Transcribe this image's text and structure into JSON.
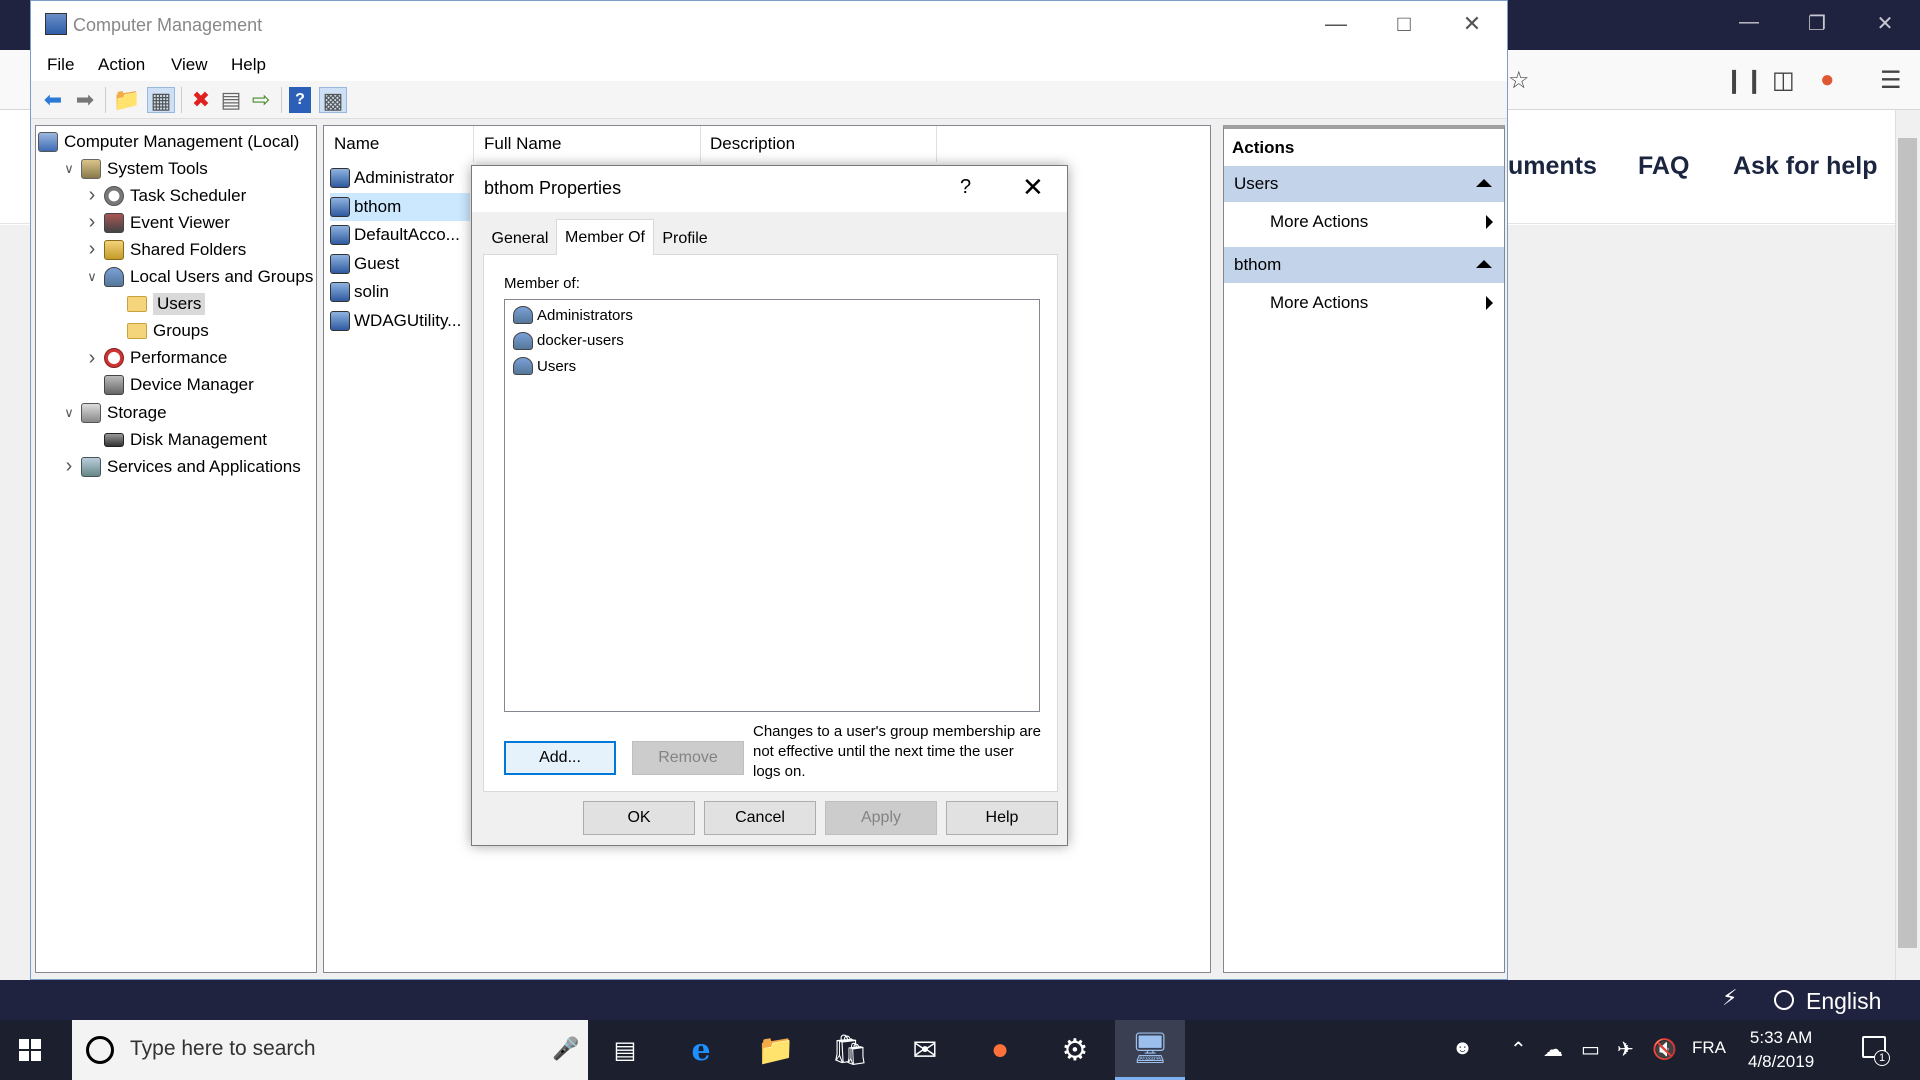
{
  "browser": {
    "nav_items": [
      "uments",
      "FAQ",
      "Ask for help"
    ],
    "status_lang": "English"
  },
  "window": {
    "title": "Computer Management",
    "menu": [
      "File",
      "Action",
      "View",
      "Help"
    ]
  },
  "tree": [
    {
      "label": "Computer Management (Local)",
      "indent": 0,
      "chevron": "",
      "icon": "computer-management-icon"
    },
    {
      "label": "System Tools",
      "indent": 1,
      "chevron": "v",
      "icon": "system-tools-icon"
    },
    {
      "label": "Task Scheduler",
      "indent": 2,
      "chevron": ">",
      "icon": "clock-icon"
    },
    {
      "label": "Event Viewer",
      "indent": 2,
      "chevron": ">",
      "icon": "event-viewer-icon"
    },
    {
      "label": "Shared Folders",
      "indent": 2,
      "chevron": ">",
      "icon": "shared-folders-icon"
    },
    {
      "label": "Local Users and Groups",
      "indent": 2,
      "chevron": "v",
      "icon": "users-icon"
    },
    {
      "label": "Users",
      "indent": 3,
      "chevron": "",
      "icon": "folder-icon",
      "selected": true
    },
    {
      "label": "Groups",
      "indent": 3,
      "chevron": "",
      "icon": "folder-icon"
    },
    {
      "label": "Performance",
      "indent": 2,
      "chevron": ">",
      "icon": "performance-icon"
    },
    {
      "label": "Device Manager",
      "indent": 2,
      "chevron": "",
      "icon": "device-manager-icon"
    },
    {
      "label": "Storage",
      "indent": 1,
      "chevron": "v",
      "icon": "storage-icon"
    },
    {
      "label": "Disk Management",
      "indent": 2,
      "chevron": "",
      "icon": "disk-icon"
    },
    {
      "label": "Services and Applications",
      "indent": 1,
      "chevron": ">",
      "icon": "services-icon"
    }
  ],
  "list": {
    "columns": [
      "Name",
      "Full Name",
      "Description"
    ],
    "rows": [
      "Administrator",
      "bthom",
      "DefaultAcco...",
      "Guest",
      "solin",
      "WDAGUtility..."
    ],
    "selected_row": "bthom"
  },
  "actions": {
    "header": "Actions",
    "groups": [
      {
        "title": "Users",
        "item": "More Actions"
      },
      {
        "title": "bthom",
        "item": "More Actions"
      }
    ]
  },
  "dialog": {
    "title": "bthom Properties",
    "help_glyph": "?",
    "tabs": [
      "General",
      "Member Of",
      "Profile"
    ],
    "active_tab": "Member Of",
    "member_of_label": "Member of:",
    "members": [
      "Administrators",
      "docker-users",
      "Users"
    ],
    "add_label": "Add...",
    "remove_label": "Remove",
    "note": "Changes to a user's group membership are not effective until the next time the user logs on.",
    "ok_label": "OK",
    "cancel_label": "Cancel",
    "apply_label": "Apply",
    "help_label": "Help"
  },
  "taskbar": {
    "search_placeholder": "Type here to search",
    "lang": "FRA",
    "time": "5:33 AM",
    "date": "4/8/2019",
    "notification_count": "1"
  },
  "colors": {
    "selection": "#cce8ff",
    "actions_group": "#c3d4ea",
    "accent": "#0078d7",
    "taskbar": "#1b1f2e",
    "browser_frame": "#202340"
  }
}
